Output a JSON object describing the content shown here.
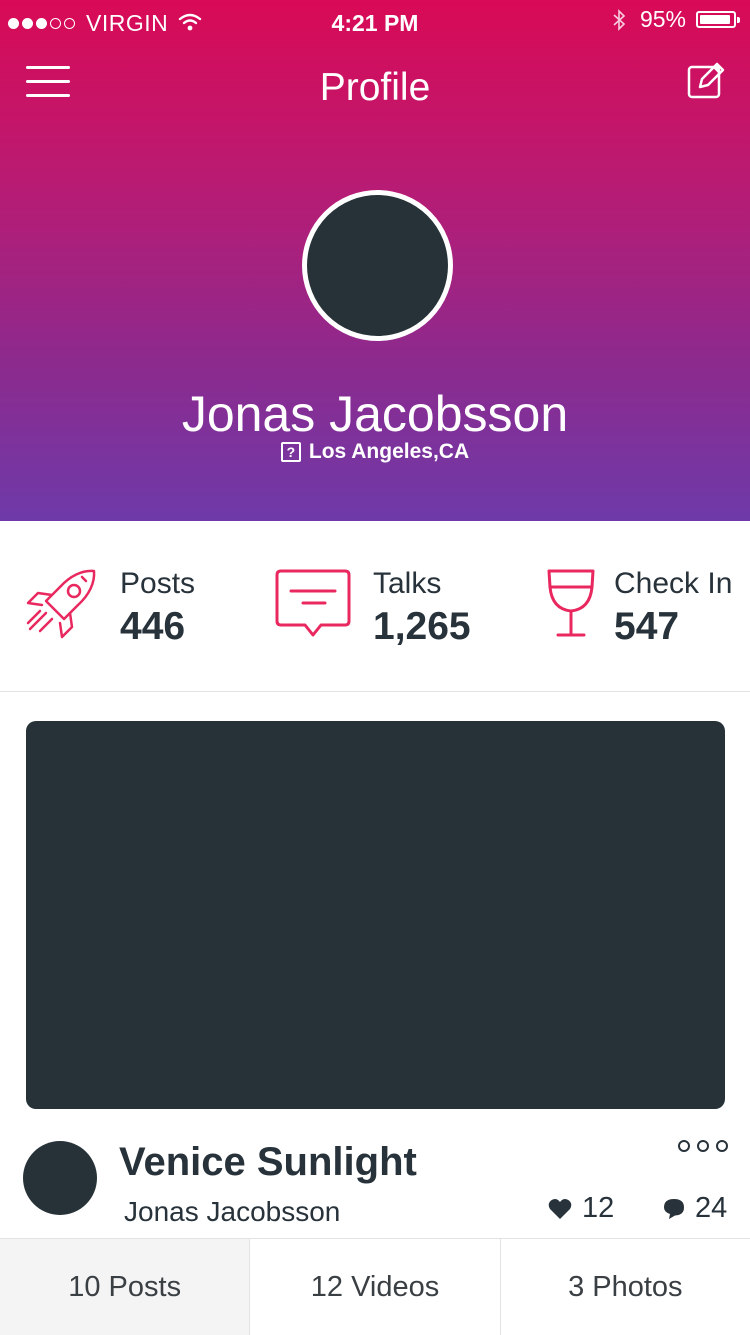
{
  "status_bar": {
    "carrier": "VIRGIN",
    "signal_bars_filled": 3,
    "signal_bars_total": 5,
    "time": "4:21 PM",
    "battery": "95%",
    "battery_level": 0.95
  },
  "nav": {
    "title": "Profile",
    "menu_icon": "hamburger-icon",
    "edit_icon": "edit-icon"
  },
  "profile": {
    "name": "Jonas Jacobsson",
    "location": "Los Angeles,CA",
    "location_icon_glyph": "?"
  },
  "stats": [
    {
      "label": "Posts",
      "value": "446",
      "icon": "rocket-icon"
    },
    {
      "label": "Talks",
      "value": "1,265",
      "icon": "chat-icon"
    },
    {
      "label": "Check In",
      "value": "547",
      "icon": "wine-glass-icon"
    }
  ],
  "post": {
    "title": "Venice Sunlight",
    "author": "Jonas Jacobsson",
    "likes": "12",
    "comments": "24"
  },
  "tabs": [
    {
      "label": "10 Posts",
      "selected": true
    },
    {
      "label": "12 Videos",
      "selected": false
    },
    {
      "label": "3 Photos",
      "selected": false
    }
  ],
  "colors": {
    "accent": "#e8285f",
    "gradient_top": "#d90a56",
    "gradient_bottom": "#6e3aa9",
    "dark": "#263238"
  }
}
